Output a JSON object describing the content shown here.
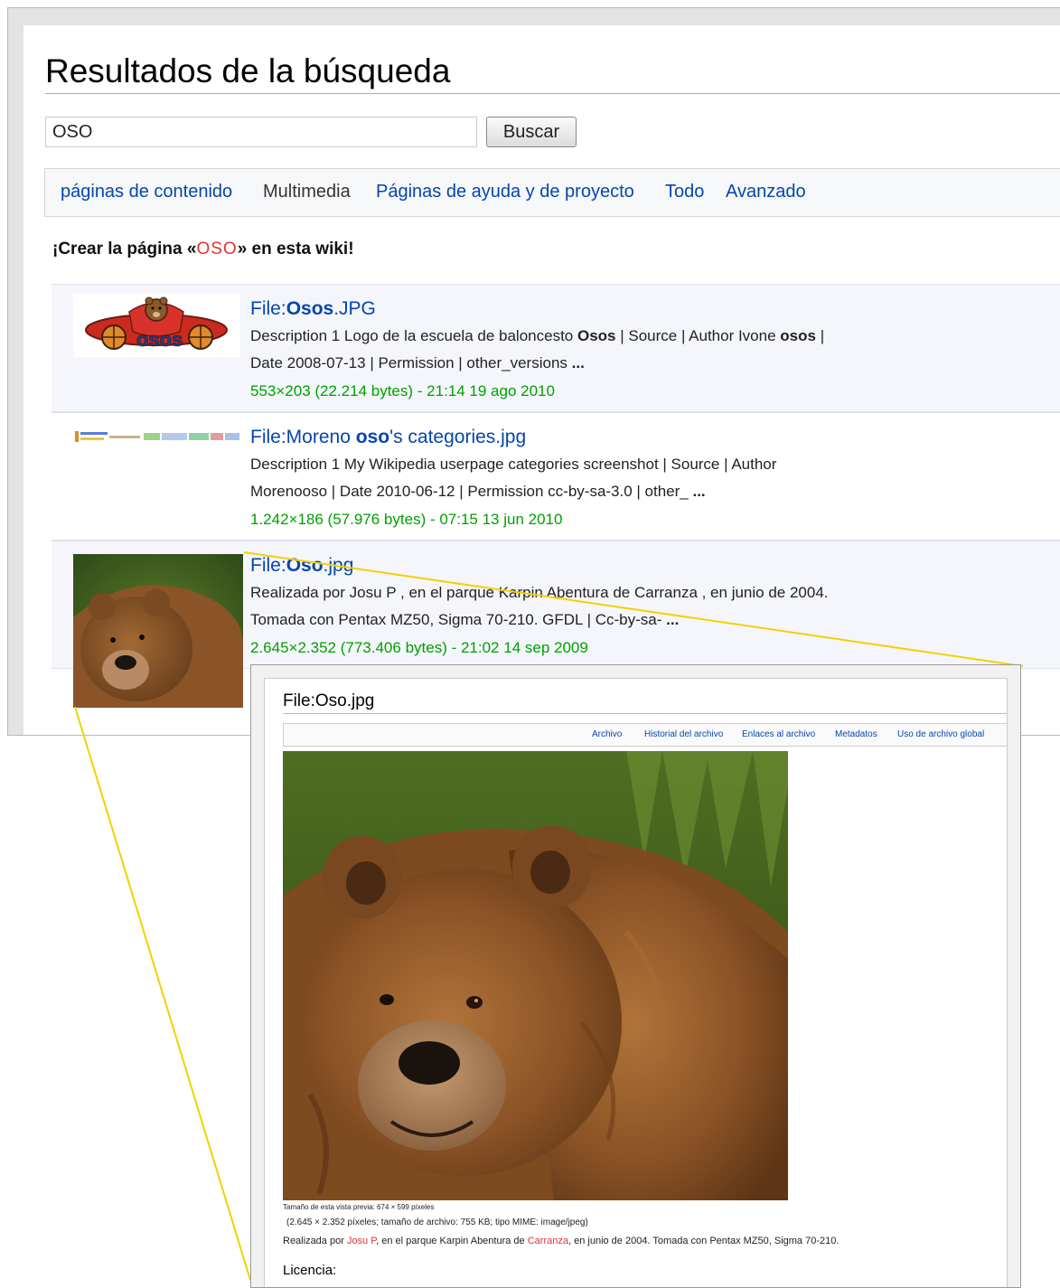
{
  "page": {
    "title": "Resultados de la búsqueda"
  },
  "search": {
    "value": "OSO",
    "button_label": "Buscar"
  },
  "filters": [
    {
      "label": "páginas de contenido"
    },
    {
      "label": "Multimedia",
      "active": true
    },
    {
      "label": "Páginas de ayuda y de proyecto"
    },
    {
      "label": "Todo"
    },
    {
      "label": "Avanzado"
    }
  ],
  "create": {
    "prefix": "¡Crear la página «",
    "term": "OSO",
    "suffix": "» en esta wiki!"
  },
  "results": [
    {
      "title_prefix": "File:",
      "title_bold": "Osos",
      "title_suffix": ".JPG",
      "line1_a": "Description 1 Logo de la escuela de baloncesto ",
      "line1_b": "Osos",
      "line1_c": " | Source | Author Ivone ",
      "line1_d": "osos",
      "line1_e": " |",
      "line2_a": "Date 2008-07-13 | Permission | other_versions ",
      "line2_b": "...",
      "meta": "553×203 (22.214 bytes) - 21:14 19 ago 2010"
    },
    {
      "title_prefix": "File:Moreno ",
      "title_bold": "oso",
      "title_suffix": "'s categories.jpg",
      "line1_a": "Description 1 My Wikipedia userpage categories screenshot | Source | Author",
      "line2_a": "Morenooso | Date 2010-06-12 | Permission cc-by-sa-3.0 | other_ ",
      "line2_b": "...",
      "meta": "1.242×186 (57.976 bytes) - 07:15 13 jun 2010"
    },
    {
      "title_prefix": "File:",
      "title_bold": "Oso",
      "title_suffix": ".jpg",
      "line1_a": "Realizada por Josu P , en el parque Karpin Abentura de Carranza , en junio de 2004.",
      "line2_a": "Tomada con Pentax MZ50, Sigma 70-210. GFDL | Cc-by-sa- ",
      "line2_b": "...",
      "meta": "2.645×2.352 (773.406 bytes) - 21:02 14 sep 2009"
    }
  ],
  "popup": {
    "title": "File:Oso.jpg",
    "tabs": [
      "Archivo",
      "Historial del archivo",
      "Enlaces al archivo",
      "Metadatos",
      "Uso de archivo global"
    ],
    "preview_size": "Tamaño de esta vista previa: 674 × 599 píxeles",
    "file_info": "(2.645 × 2.352 píxeles; tamaño de archivo: 755 KB; tipo MIME: image/jpeg)",
    "desc_a": "Realizada por ",
    "desc_link1": "Josu P",
    "desc_b": ", en el parque Karpin Abentura de ",
    "desc_link2": "Carranza",
    "desc_c": ", en junio de 2004. Tomada con Pentax MZ50, Sigma 70-210.",
    "license_heading": "Licencia:"
  },
  "colors": {
    "link": "#0645ad",
    "red_link": "#d33333",
    "meta_green": "#00a000",
    "zoom_line": "#f3d100"
  }
}
